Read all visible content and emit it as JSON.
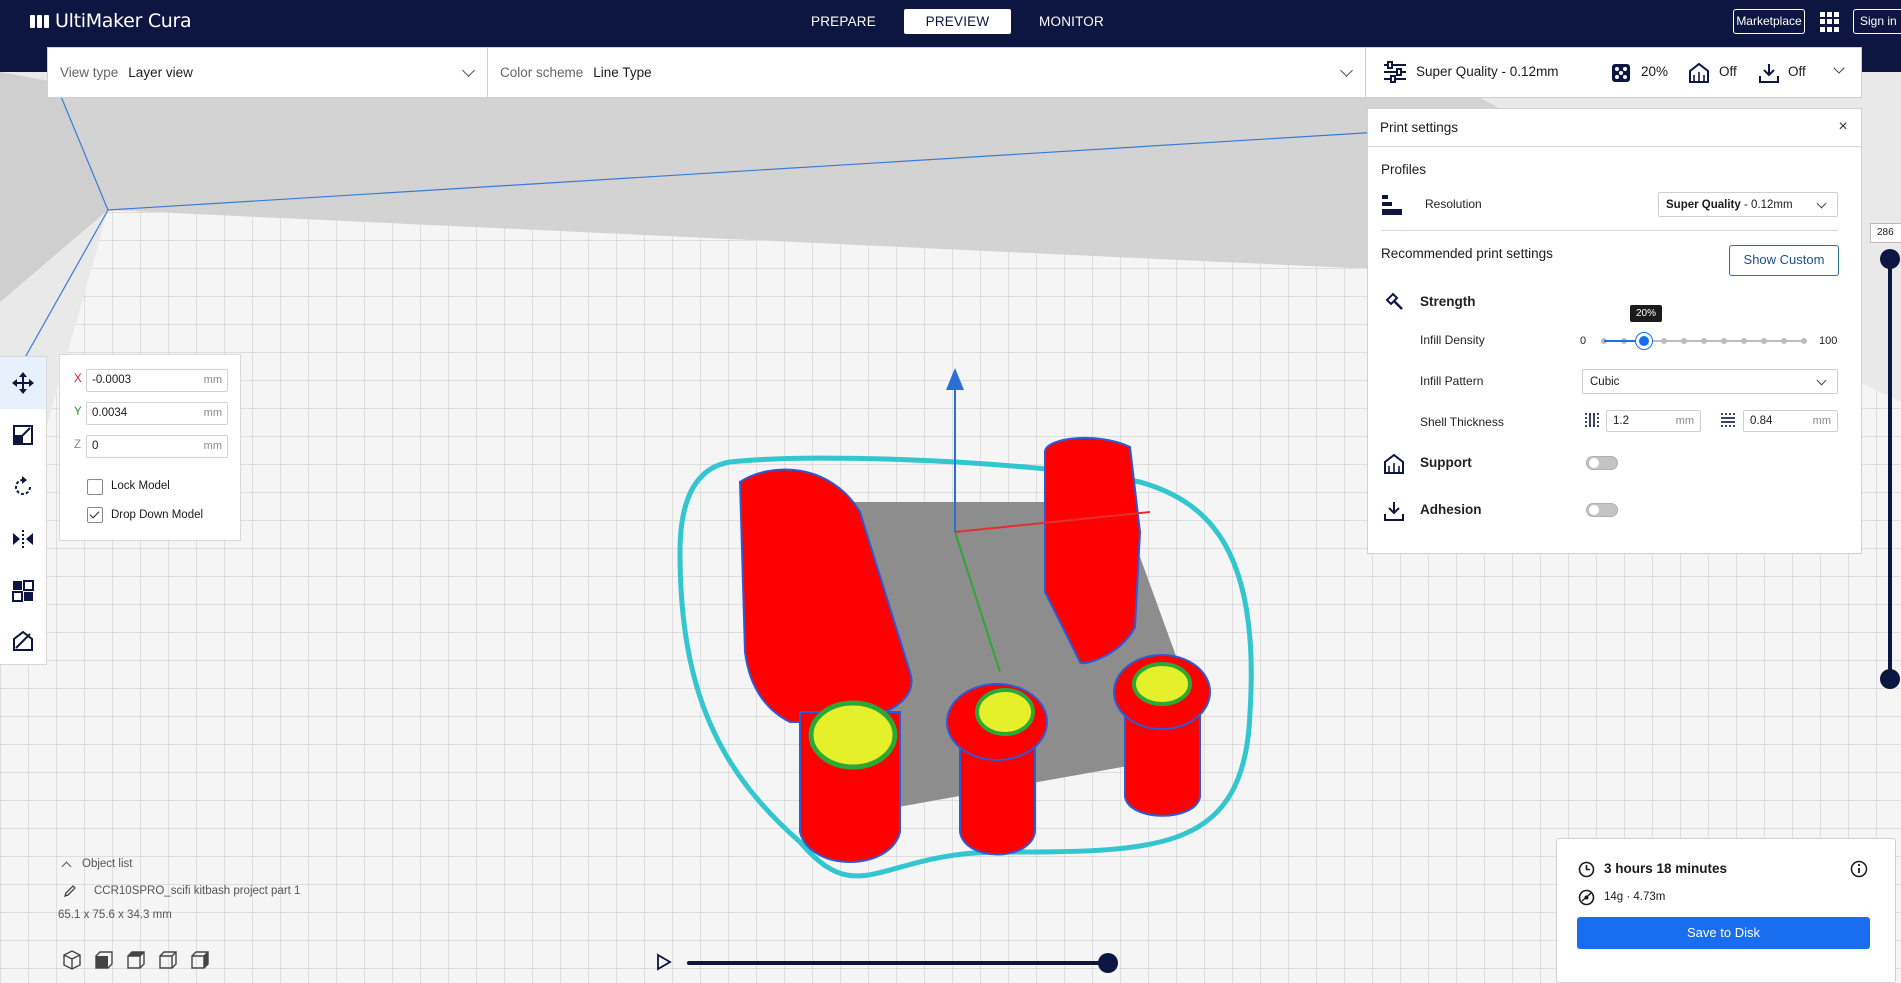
{
  "app": {
    "title": "UltiMaker Cura",
    "stages": [
      "PREPARE",
      "PREVIEW",
      "MONITOR"
    ],
    "active_stage": "PREVIEW",
    "marketplace_label": "Marketplace",
    "signin_label": "Sign in"
  },
  "viewbar": {
    "view_type_label": "View type",
    "view_type_value": "Layer view",
    "color_scheme_label": "Color scheme",
    "color_scheme_value": "Line Type"
  },
  "printbar": {
    "profile": "Super Quality - 0.12mm",
    "infill": "20%",
    "support": "Off",
    "adhesion": "Off"
  },
  "print_settings": {
    "title": "Print settings",
    "profiles_label": "Profiles",
    "resolution_label": "Resolution",
    "resolution_bold": "Super Quality",
    "resolution_rest": " - 0.12mm",
    "recommended_label": "Recommended print settings",
    "show_custom_label": "Show Custom",
    "strength_label": "Strength",
    "infill_density_label": "Infill Density",
    "infill_min": "0",
    "infill_max": "100",
    "infill_value_tip": "20%",
    "infill_value": 20,
    "infill_pattern_label": "Infill Pattern",
    "infill_pattern_value": "Cubic",
    "shell_thickness_label": "Shell Thickness",
    "wall_thickness": "1.2",
    "top_bottom_thickness": "0.84",
    "unit_mm": "mm",
    "support_label": "Support",
    "adhesion_label": "Adhesion"
  },
  "move_panel": {
    "x_label": "X",
    "x_value": "-0.0003",
    "y_label": "Y",
    "y_value": "0.0034",
    "z_label": "Z",
    "z_value": "0",
    "unit": "mm",
    "lock_model_label": "Lock Model",
    "drop_down_label": "Drop Down Model"
  },
  "object_list": {
    "header": "Object list",
    "item_name": "CCR10SPRO_scifi kitbash project part 1",
    "dimensions": "65.1 x 75.6 x 34.3 mm"
  },
  "layer_view": {
    "max_layer": "286"
  },
  "estimate": {
    "time": "3 hours 18 minutes",
    "material": "14g · 4.73m",
    "save_label": "Save to Disk"
  },
  "colors": {
    "header_bg": "#0d1541",
    "accent_blue": "#196ef0",
    "part_red": "#ff0000",
    "outline_cyan": "#34c6cf"
  }
}
